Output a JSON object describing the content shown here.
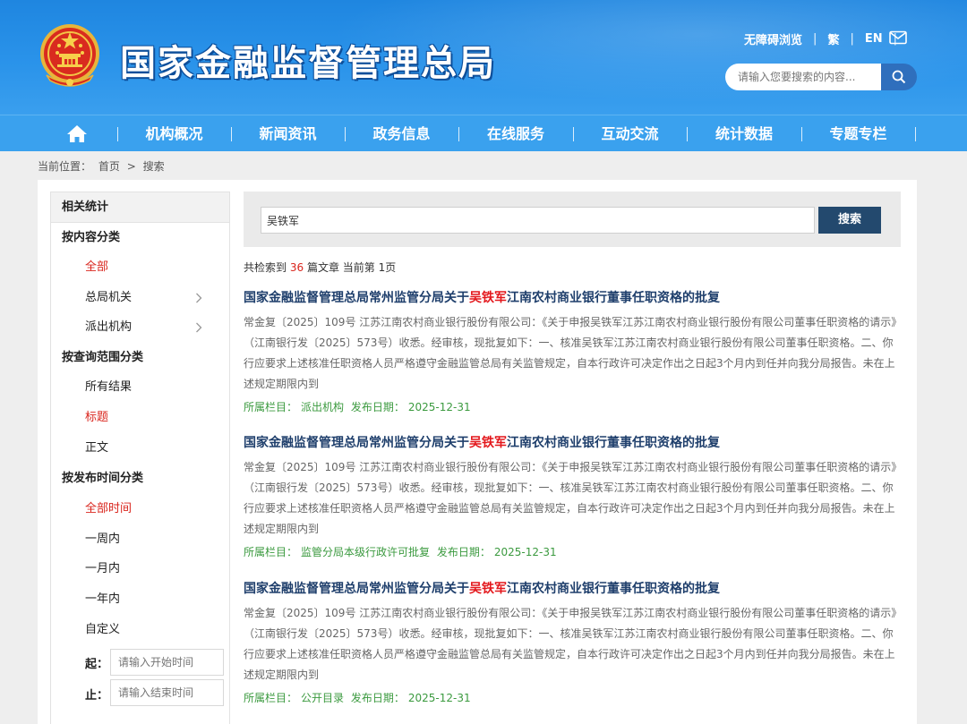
{
  "header": {
    "site_title": "国家金融监督管理总局",
    "links": [
      "无障碍浏览",
      "繁",
      "EN"
    ],
    "search_placeholder": "请输入您要搜索的内容..."
  },
  "nav": {
    "items": [
      "机构概况",
      "新闻资讯",
      "政务信息",
      "在线服务",
      "互动交流",
      "统计数据",
      "专题专栏"
    ]
  },
  "breadcrumb": {
    "prefix": "当前位置：",
    "home": "首页",
    "separator": ">",
    "current": "搜索"
  },
  "sidebar": {
    "header": "相关统计",
    "categories": {
      "content": "按内容分类",
      "scope": "按查询范围分类",
      "time": "按发布时间分类"
    },
    "content_options": [
      "全部",
      "总局机关",
      "派出机构"
    ],
    "scope_options": [
      "所有结果",
      "标题",
      "正文"
    ],
    "time_options": [
      "全部时间",
      "一周内",
      "一月内",
      "一年内",
      "自定义"
    ],
    "start_label": "起：",
    "end_label": "止：",
    "start_placeholder": "请输入开始时间",
    "end_placeholder": "请输入结束时间"
  },
  "search": {
    "query": "吴铁军",
    "button": "搜索"
  },
  "summary": {
    "prefix": "共检索到",
    "count": "36",
    "suffix": "篇文章 当前第 1页"
  },
  "results": [
    {
      "title_before": "国家金融监督管理总局常州监管分局关于",
      "title_highlight": "吴铁军",
      "title_after": "江南农村商业银行董事任职资格的批复",
      "body": "常金复〔2025〕109号 江苏江南农村商业银行股份有限公司：《关于申报吴铁军江苏江南农村商业银行股份有限公司董事任职资格的请示》（江南银行发〔2025〕573号）收悉。经审核，现批复如下：一、核准吴铁军江苏江南农村商业银行股份有限公司董事任职资格。二、你行应要求上述核准任职资格人员严格遵守金融监管总局有关监管规定，自本行政许可决定作出之日起3个月内到任并向我分局报告。未在上述规定期限内到",
      "column_label": "所属栏目：",
      "column": "派出机构",
      "date_label": "发布日期：",
      "date": "2025-12-31"
    },
    {
      "title_before": "国家金融监督管理总局常州监管分局关于",
      "title_highlight": "吴铁军",
      "title_after": "江南农村商业银行董事任职资格的批复",
      "body": "常金复〔2025〕109号 江苏江南农村商业银行股份有限公司：《关于申报吴铁军江苏江南农村商业银行股份有限公司董事任职资格的请示》（江南银行发〔2025〕573号）收悉。经审核，现批复如下：一、核准吴铁军江苏江南农村商业银行股份有限公司董事任职资格。二、你行应要求上述核准任职资格人员严格遵守金融监管总局有关监管规定，自本行政许可决定作出之日起3个月内到任并向我分局报告。未在上述规定期限内到",
      "column_label": "所属栏目：",
      "column": "监管分局本级行政许可批复",
      "date_label": "发布日期：",
      "date": "2025-12-31"
    },
    {
      "title_before": "国家金融监督管理总局常州监管分局关于",
      "title_highlight": "吴铁军",
      "title_after": "江南农村商业银行董事任职资格的批复",
      "body": "常金复〔2025〕109号 江苏江南农村商业银行股份有限公司：《关于申报吴铁军江苏江南农村商业银行股份有限公司董事任职资格的请示》（江南银行发〔2025〕573号）收悉。经审核，现批复如下：一、核准吴铁军江苏江南农村商业银行股份有限公司董事任职资格。二、你行应要求上述核准任职资格人员严格遵守金融监管总局有关监管规定，自本行政许可决定作出之日起3个月内到任并向我分局报告。未在上述规定期限内到",
      "column_label": "所属栏目：",
      "column": "公开目录",
      "date_label": "发布日期：",
      "date": "2025-12-31"
    }
  ],
  "colors": {
    "header_blue": "#2a93ea",
    "nav_blue": "#3aa1ee",
    "highlight_red": "#e3161b",
    "active_red": "#d9251d",
    "meta_green": "#3b9a3f",
    "title_navy": "#1f3f6c",
    "button_navy": "#23496e"
  },
  "icons": [
    "national-emblem-icon",
    "mail-icon",
    "search-icon",
    "home-icon",
    "chevron-right-icon"
  ]
}
